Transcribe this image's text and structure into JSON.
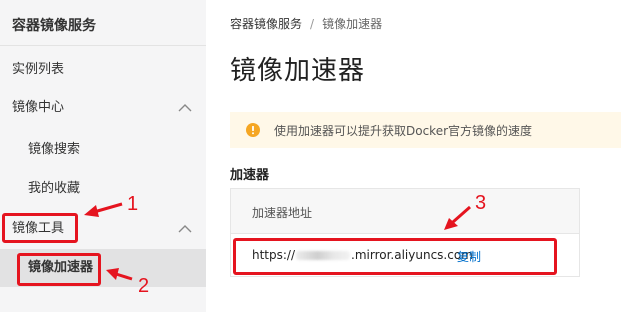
{
  "sidebar": {
    "title": "容器镜像服务",
    "items": [
      {
        "label": "实例列表"
      },
      {
        "label": "镜像中心",
        "icon": "chevron-up-icon"
      },
      {
        "label": "镜像搜索"
      },
      {
        "label": "我的收藏"
      },
      {
        "label": "镜像工具",
        "icon": "chevron-up-icon"
      },
      {
        "label": "镜像加速器",
        "active": true
      }
    ]
  },
  "breadcrumb": {
    "root": "容器镜像服务",
    "separator": "/",
    "current": "镜像加速器"
  },
  "page": {
    "title": "镜像加速器",
    "notice": "使用加速器可以提升获取Docker官方镜像的速度",
    "section_title": "加速器"
  },
  "accelerator": {
    "column_header": "加速器地址",
    "url_prefix": "https://",
    "url_suffix": ".mirror.aliyuncs.com",
    "copy_label": "复制"
  },
  "annotations": {
    "labels": [
      "1",
      "2",
      "3"
    ],
    "color": "#e5141f"
  },
  "colors": {
    "link": "#0070cc",
    "notice_bg": "#fff8e8",
    "warning_icon": "#f5a623",
    "sidebar_bg": "#f5f5f6"
  }
}
